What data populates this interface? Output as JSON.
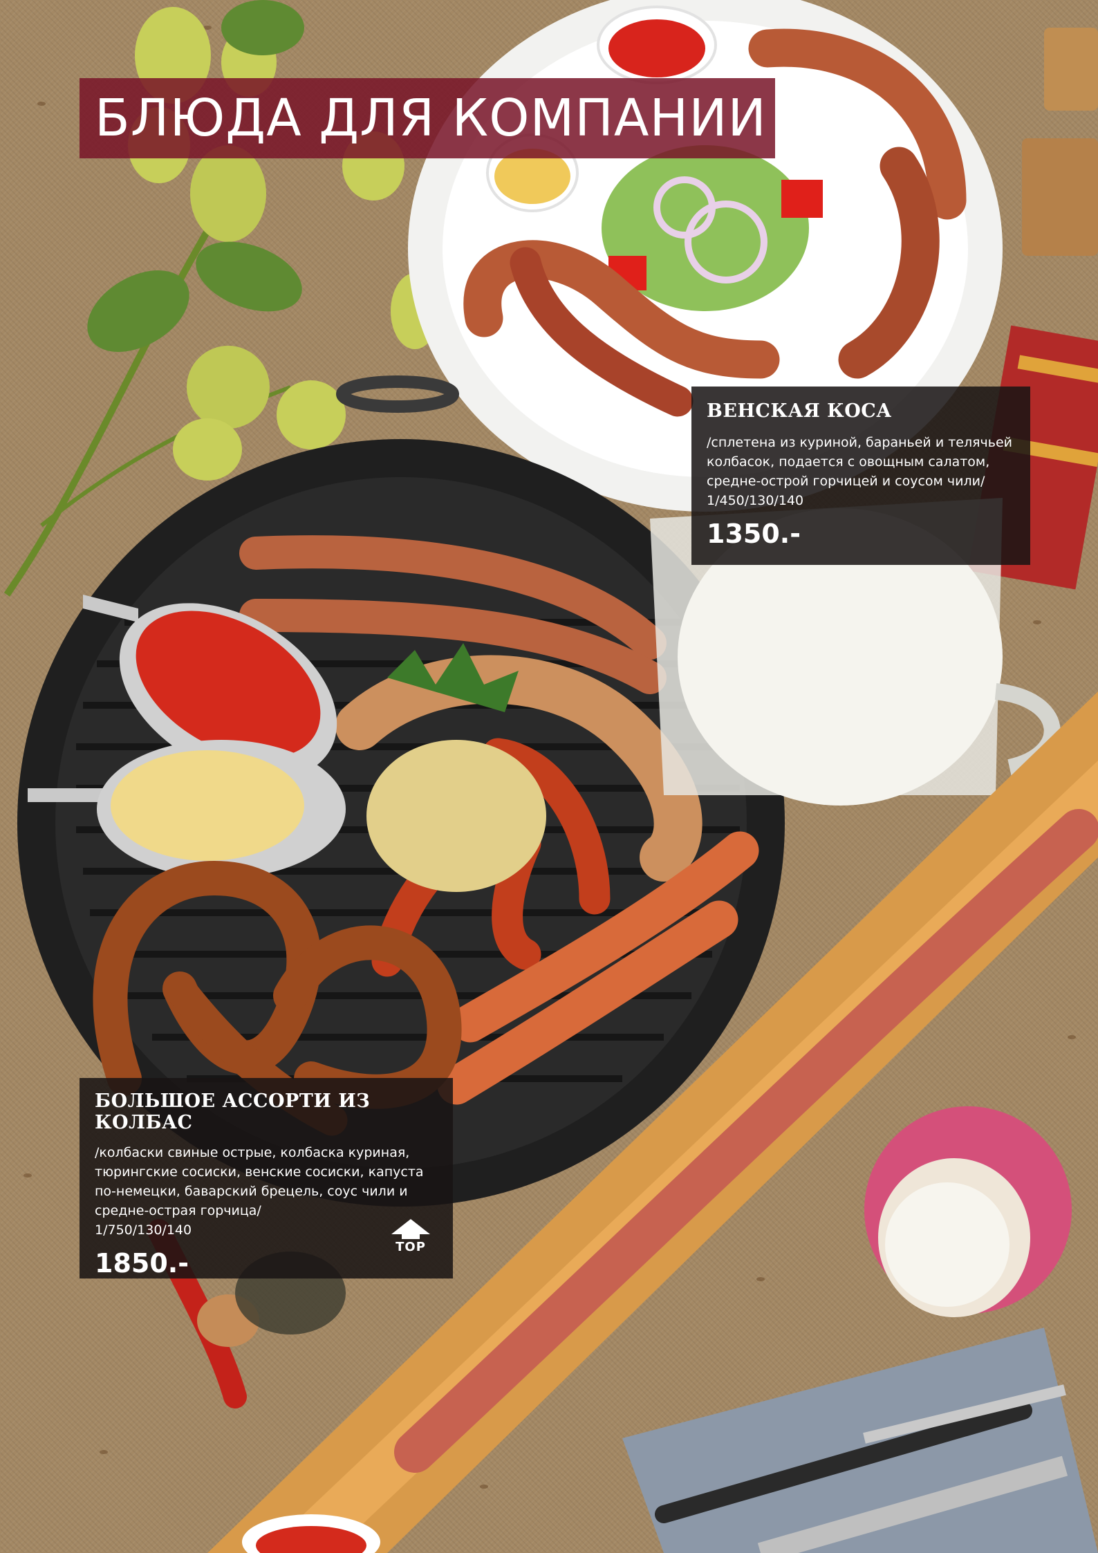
{
  "page": {
    "title": "БЛЮДА ДЛЯ КОМПАНИИ"
  },
  "dishes": [
    {
      "name": "ВЕНСКАЯ КОСА",
      "description_lines": [
        "/сплетена из куриной, бараньей и телячьей",
        "колбасок, подается с овощным салатом,",
        "средне-острой горчицей и соусом чили/",
        "1/450/130/140"
      ],
      "price": "1350.-"
    },
    {
      "name": "БОЛЬШОЕ АССОРТИ ИЗ КОЛБАС",
      "description_lines": [
        "/колбаски свиные острые, колбаска куриная,",
        "тюрингские сосиски, венские сосиски, капуста",
        "по-немецки, баварский брецель, соус чили и",
        "средне-острая горчица/",
        "1/750/130/140"
      ],
      "price": "1850.-"
    }
  ],
  "nav": {
    "top_label": "TOP",
    "top_icon": "arrow-up-icon"
  },
  "colors": {
    "banner": "#781428",
    "panel": "#181414",
    "text": "#ffffff"
  }
}
